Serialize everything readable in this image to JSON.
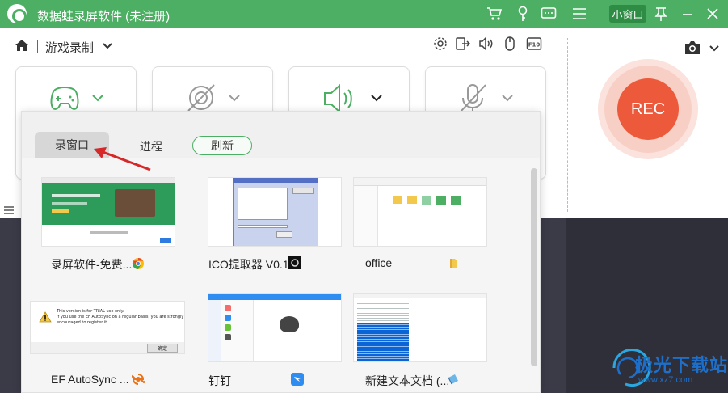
{
  "app": {
    "title": "数据蛙录屏软件 (未注册)",
    "mini_window_label": "小窗口"
  },
  "toolbar": {
    "mode_label": "游戏录制"
  },
  "rec": {
    "label": "REC"
  },
  "popup": {
    "tabs": {
      "window": "录窗口",
      "process": "进程",
      "refresh": "刷新"
    },
    "windows": [
      {
        "label": "录屏软件-免费...",
        "badge_icon": "chrome-icon"
      },
      {
        "label": "ICO提取器 V0.1",
        "badge_icon": "ico-extractor-icon"
      },
      {
        "label": "office",
        "badge_icon": "folder-icon"
      },
      {
        "label": "EF AutoSync ...",
        "badge_icon": "autosync-icon"
      },
      {
        "label": "钉钉",
        "badge_icon": "dingtalk-icon"
      },
      {
        "label": "新建文本文档 (...",
        "badge_icon": "notepad-icon"
      }
    ],
    "trial_dialog": {
      "line1": "This version is for TRIAL use only.",
      "line2": "If you use the EF AutoSync on a regular basis, you are strongly",
      "line3": "encouraged to register it.",
      "ok": "确定"
    }
  },
  "watermark": {
    "text": "极光下载站",
    "url": "www.xz7.com"
  },
  "colors": {
    "brand_green": "#4caf63",
    "rec_red": "#ec5a3b"
  }
}
